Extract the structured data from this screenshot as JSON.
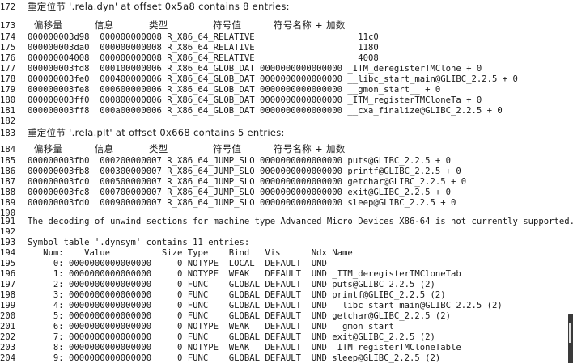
{
  "lines": [
    {
      "n": "172",
      "t": "重定位节 '.rela.dyn' at offset 0x5a8 contains 8 entries:",
      "cjk": true
    },
    {
      "n": "173",
      "t": "  偏移量          信息           类型              符号值          符号名称 + 加数",
      "cjk": true
    },
    {
      "n": "174",
      "t": "000000003d98  000000000008 R_X86_64_RELATIVE                    11c0"
    },
    {
      "n": "175",
      "t": "000000003da0  000000000008 R_X86_64_RELATIVE                    1180"
    },
    {
      "n": "176",
      "t": "000000004008  000000000008 R_X86_64_RELATIVE                    4008"
    },
    {
      "n": "177",
      "t": "000000003fd8  000100000006 R_X86_64_GLOB_DAT 0000000000000000 _ITM_deregisterTMClone + 0"
    },
    {
      "n": "178",
      "t": "000000003fe0  000400000006 R_X86_64_GLOB_DAT 0000000000000000 __libc_start_main@GLIBC_2.2.5 + 0"
    },
    {
      "n": "179",
      "t": "000000003fe8  000600000006 R_X86_64_GLOB_DAT 0000000000000000 __gmon_start__ + 0"
    },
    {
      "n": "180",
      "t": "000000003ff0  000800000006 R_X86_64_GLOB_DAT 0000000000000000 _ITM_registerTMCloneTa + 0"
    },
    {
      "n": "181",
      "t": "000000003ff8  000a00000006 R_X86_64_GLOB_DAT 0000000000000000 __cxa_finalize@GLIBC_2.2.5 + 0"
    },
    {
      "n": "182",
      "t": ""
    },
    {
      "n": "183",
      "t": "重定位节 '.rela.plt' at offset 0x668 contains 5 entries:",
      "cjk": true
    },
    {
      "n": "184",
      "t": "  偏移量          信息           类型              符号值          符号名称 + 加数",
      "cjk": true
    },
    {
      "n": "185",
      "t": "000000003fb0  000200000007 R_X86_64_JUMP_SLO 0000000000000000 puts@GLIBC_2.2.5 + 0"
    },
    {
      "n": "186",
      "t": "000000003fb8  000300000007 R_X86_64_JUMP_SLO 0000000000000000 printf@GLIBC_2.2.5 + 0"
    },
    {
      "n": "187",
      "t": "000000003fc0  000500000007 R_X86_64_JUMP_SLO 0000000000000000 getchar@GLIBC_2.2.5 + 0"
    },
    {
      "n": "188",
      "t": "000000003fc8  000700000007 R_X86_64_JUMP_SLO 0000000000000000 exit@GLIBC_2.2.5 + 0"
    },
    {
      "n": "189",
      "t": "000000003fd0  000900000007 R_X86_64_JUMP_SLO 0000000000000000 sleep@GLIBC_2.2.5 + 0"
    },
    {
      "n": "190",
      "t": ""
    },
    {
      "n": "191",
      "t": "The decoding of unwind sections for machine type Advanced Micro Devices X86-64 is not currently supported."
    },
    {
      "n": "192",
      "t": ""
    },
    {
      "n": "193",
      "t": "Symbol table '.dynsym' contains 11 entries:"
    },
    {
      "n": "194",
      "t": "   Num:    Value          Size Type    Bind   Vis      Ndx Name"
    },
    {
      "n": "195",
      "t": "     0: 0000000000000000     0 NOTYPE  LOCAL  DEFAULT  UND"
    },
    {
      "n": "196",
      "t": "     1: 0000000000000000     0 NOTYPE  WEAK   DEFAULT  UND _ITM_deregisterTMCloneTab"
    },
    {
      "n": "197",
      "t": "     2: 0000000000000000     0 FUNC    GLOBAL DEFAULT  UND puts@GLIBC_2.2.5 (2)"
    },
    {
      "n": "198",
      "t": "     3: 0000000000000000     0 FUNC    GLOBAL DEFAULT  UND printf@GLIBC_2.2.5 (2)"
    },
    {
      "n": "199",
      "t": "     4: 0000000000000000     0 FUNC    GLOBAL DEFAULT  UND __libc_start_main@GLIBC_2.2.5 (2)"
    },
    {
      "n": "200",
      "t": "     5: 0000000000000000     0 FUNC    GLOBAL DEFAULT  UND getchar@GLIBC_2.2.5 (2)"
    },
    {
      "n": "201",
      "t": "     6: 0000000000000000     0 NOTYPE  WEAK   DEFAULT  UND __gmon_start__"
    },
    {
      "n": "202",
      "t": "     7: 0000000000000000     0 FUNC    GLOBAL DEFAULT  UND exit@GLIBC_2.2.5 (2)"
    },
    {
      "n": "203",
      "t": "     8: 0000000000000000     0 NOTYPE  WEAK   DEFAULT  UND _ITM_registerTMCloneTable"
    },
    {
      "n": "204",
      "t": "     9: 0000000000000000     0 FUNC    GLOBAL DEFAULT  UND sleep@GLIBC_2.2.5 (2)"
    }
  ]
}
